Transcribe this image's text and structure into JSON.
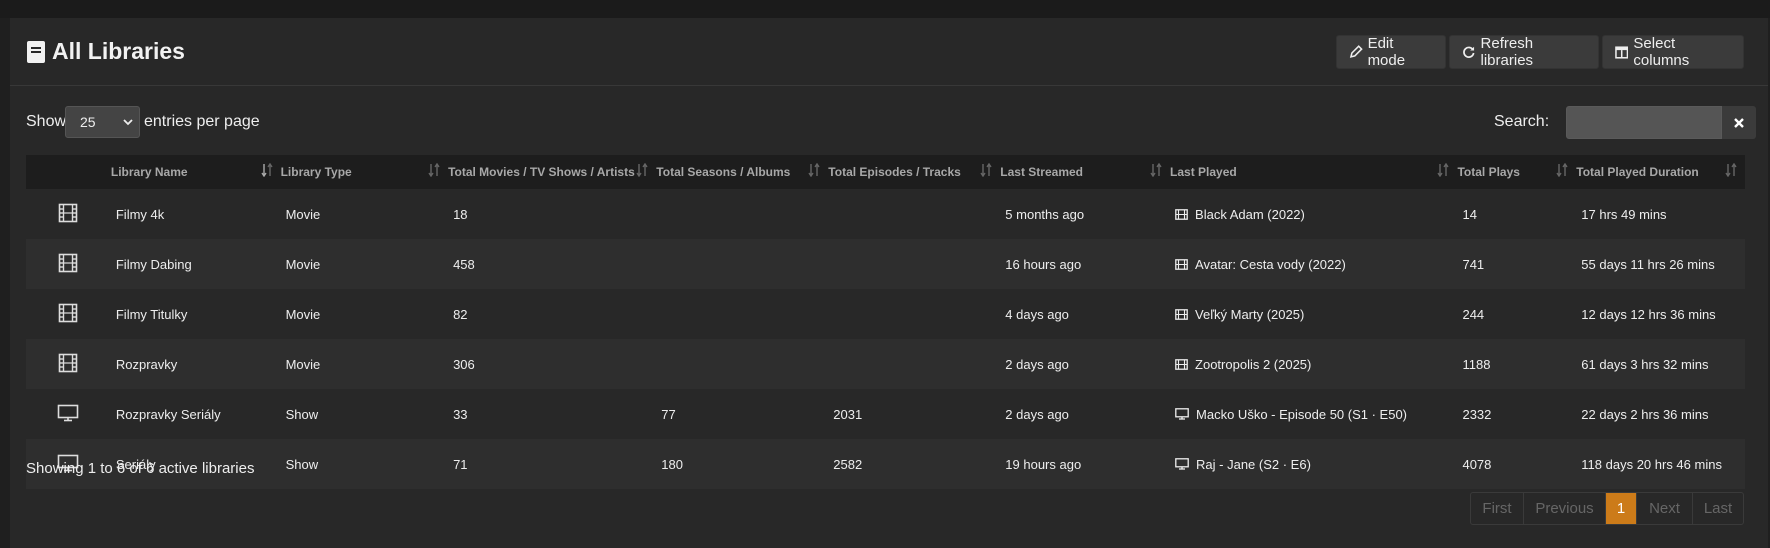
{
  "header": {
    "title": "All Libraries",
    "edit_mode": "Edit mode",
    "refresh": "Refresh libraries",
    "select_columns": "Select columns"
  },
  "controls": {
    "show_label": "Show",
    "entries_value": "25",
    "per_page_label": "entries per page",
    "search_label": "Search:"
  },
  "table": {
    "columns": [
      "",
      "Library Name",
      "Library Type",
      "Total Movies / TV Shows / Artists",
      "Total Seasons / Albums",
      "Total Episodes / Tracks",
      "Last Streamed",
      "Last Played",
      "Total Plays",
      "Total Played Duration"
    ],
    "rows": [
      {
        "icon": "film-icon",
        "name": "Filmy 4k",
        "type": "Movie",
        "total_items": "18",
        "seasons": "",
        "episodes": "",
        "last_streamed": "5 months ago",
        "last_played_icon": "film-icon",
        "last_played": "Black Adam (2022)",
        "plays": "14",
        "duration": "17 hrs 49 mins"
      },
      {
        "icon": "film-icon",
        "name": "Filmy Dabing",
        "type": "Movie",
        "total_items": "458",
        "seasons": "",
        "episodes": "",
        "last_streamed": "16 hours ago",
        "last_played_icon": "film-icon",
        "last_played": "Avatar: Cesta vody (2022)",
        "plays": "741",
        "duration": "55 days 11 hrs 26 mins"
      },
      {
        "icon": "film-icon",
        "name": "Filmy Titulky",
        "type": "Movie",
        "total_items": "82",
        "seasons": "",
        "episodes": "",
        "last_streamed": "4 days ago",
        "last_played_icon": "film-icon",
        "last_played": "Veľký Marty (2025)",
        "plays": "244",
        "duration": "12 days 12 hrs 36 mins"
      },
      {
        "icon": "film-icon",
        "name": "Rozpravky",
        "type": "Movie",
        "total_items": "306",
        "seasons": "",
        "episodes": "",
        "last_streamed": "2 days ago",
        "last_played_icon": "film-icon",
        "last_played": "Zootropolis 2 (2025)",
        "plays": "1188",
        "duration": "61 days 3 hrs 32 mins"
      },
      {
        "icon": "monitor-icon",
        "name": "Rozpravky Seriály",
        "type": "Show",
        "total_items": "33",
        "seasons": "77",
        "episodes": "2031",
        "last_streamed": "2 days ago",
        "last_played_icon": "monitor-icon",
        "last_played": "Macko Uško - Episode 50 (S1 · E50)",
        "plays": "2332",
        "duration": "22 days 2 hrs 36 mins"
      },
      {
        "icon": "monitor-icon",
        "name": "Seriály",
        "type": "Show",
        "total_items": "71",
        "seasons": "180",
        "episodes": "2582",
        "last_streamed": "19 hours ago",
        "last_played_icon": "monitor-icon",
        "last_played": "Raj - Jane (S2 · E6)",
        "plays": "4078",
        "duration": "118 days 20 hrs 46 mins"
      }
    ]
  },
  "footer": {
    "info": "Showing 1 to 6 of 6 active libraries",
    "pager": [
      "First",
      "Previous",
      "1",
      "Next",
      "Last"
    ]
  },
  "colors": {
    "accent": "#cc7b19",
    "background": "#282828",
    "header_row": "#1d1d1d"
  }
}
